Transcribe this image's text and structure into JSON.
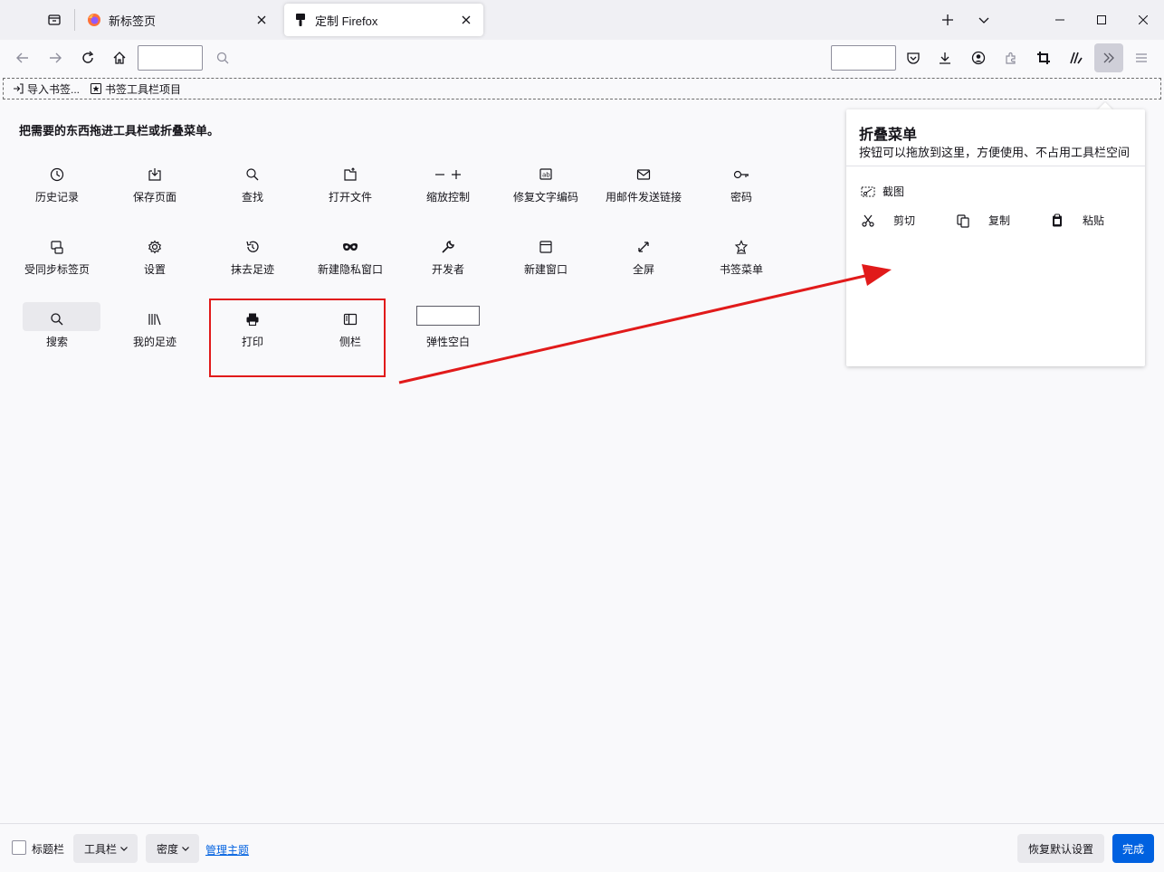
{
  "tabs": [
    {
      "label": "新标签页",
      "icon": "firefox-logo-icon",
      "active": false
    },
    {
      "label": "定制 Firefox",
      "icon": "customize-brush-icon",
      "active": true
    }
  ],
  "bookmarks": [
    {
      "label": "导入书签...",
      "icon": "import-icon"
    },
    {
      "label": "书签工具栏项目",
      "icon": "bookmark-star-box-icon"
    }
  ],
  "main": {
    "hint": "把需要的东西拖进工具栏或折叠菜单。",
    "items": [
      {
        "label": "历史记录",
        "icon": "history-clock-icon"
      },
      {
        "label": "保存页面",
        "icon": "save-page-icon"
      },
      {
        "label": "查找",
        "icon": "find-icon"
      },
      {
        "label": "打开文件",
        "icon": "open-file-icon"
      },
      {
        "label": "缩放控制",
        "icon": "zoom-controls-icon"
      },
      {
        "label": "修复文字编码",
        "icon": "text-encoding-icon"
      },
      {
        "label": "用邮件发送链接",
        "icon": "email-link-icon"
      },
      {
        "label": "密码",
        "icon": "key-icon"
      },
      {
        "label": "受同步标签页",
        "icon": "synced-tabs-icon"
      },
      {
        "label": "设置",
        "icon": "settings-gear-icon"
      },
      {
        "label": "抹去足迹",
        "icon": "forget-icon"
      },
      {
        "label": "新建隐私窗口",
        "icon": "private-mask-icon"
      },
      {
        "label": "开发者",
        "icon": "wrench-icon"
      },
      {
        "label": "新建窗口",
        "icon": "new-window-icon"
      },
      {
        "label": "全屏",
        "icon": "fullscreen-icon"
      },
      {
        "label": "书签菜单",
        "icon": "bookmarks-menu-icon"
      },
      {
        "label": "搜索",
        "icon": "search-icon"
      },
      {
        "label": "我的足迹",
        "icon": "library-icon"
      },
      {
        "label": "打印",
        "icon": "print-icon"
      },
      {
        "label": "侧栏",
        "icon": "sidebar-icon"
      },
      {
        "label": "弹性空白",
        "icon": "flexible-space-icon"
      }
    ]
  },
  "panel": {
    "title": "折叠菜单",
    "subtitle": "按钮可以拖放到这里，方便使用、不占用工具栏空间",
    "screenshot_label": "截图",
    "cut_label": "剪切",
    "copy_label": "复制",
    "paste_label": "粘贴"
  },
  "footer": {
    "titlebar_label": "标题栏",
    "toolbars_label": "工具栏",
    "density_label": "密度",
    "manage_themes": "管理主题",
    "restore_defaults": "恢复默认设置",
    "done": "完成"
  },
  "colors": {
    "accent": "#0061e0",
    "annotation_red": "#e11a1a",
    "background": "#f9f9fb"
  }
}
